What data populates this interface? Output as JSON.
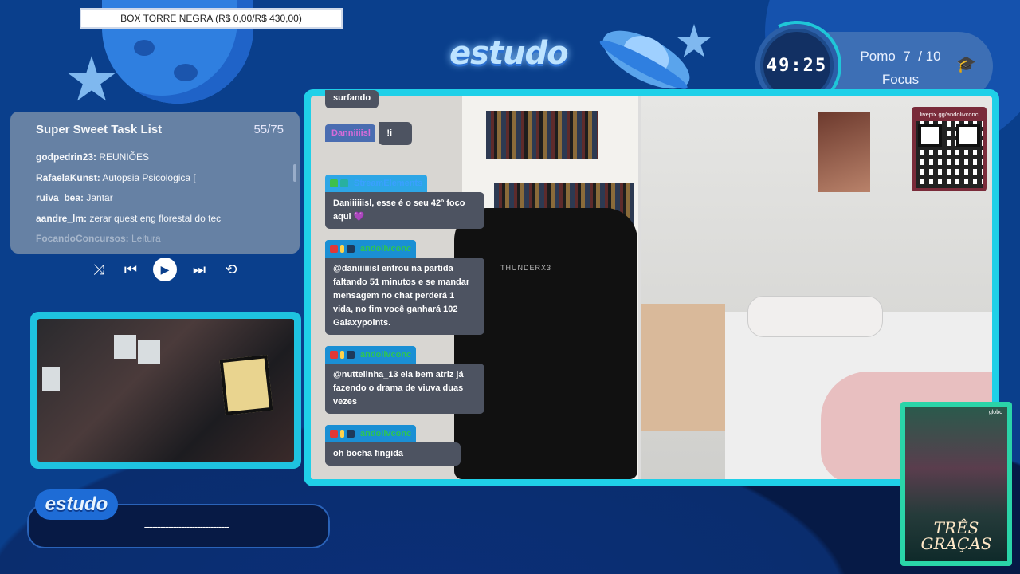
{
  "goal_bar": {
    "text": "BOX TORRE NEGRA (R$ 0,00/R$ 430,00)"
  },
  "brand": {
    "logo_text": "estudo"
  },
  "timer": {
    "time": "49:25",
    "mode_label": "Pomo",
    "pomo_current": "7",
    "pomo_total": "/ 10",
    "state": "Focus"
  },
  "task_list": {
    "title": "Super Sweet Task List",
    "count": "55/75",
    "items": [
      {
        "user": "godpedrin23:",
        "task": " REUNIÕES"
      },
      {
        "user": "RafaelaKunst:",
        "task": " Autopsia Psicologica ["
      },
      {
        "user": "ruiva_bea:",
        "task": " Jantar"
      },
      {
        "user": "aandre_lm:",
        "task": " zerar quest eng florestal do tec"
      },
      {
        "user": "FocandoConcursos:",
        "task": " Leitura"
      }
    ]
  },
  "player": {
    "shuffle": "⤨",
    "prev": "⏮",
    "play": "▶",
    "next": "⏭",
    "repeat": "⟲"
  },
  "ticker": {
    "text": "--------------------------------"
  },
  "qr": {
    "label": "livepix.gg/andolivconc"
  },
  "chat": [
    {
      "user": "",
      "body": "surfando"
    },
    {
      "user": "Danniiiisl",
      "body": "!i"
    },
    {
      "user": "StreamElements",
      "body": "Daniiiiiisl, esse é o seu 42º foco aqui 💜"
    },
    {
      "user": "andolivconc",
      "body": "@daniiiiiisl entrou na partida faltando 51 minutos e se mandar mensagem no chat perderá 1 vida, no fim você ganhará 102 Galaxypoints."
    },
    {
      "user": "andolivconc",
      "body": "@nuttelinha_13 ela bem atriz já fazendo o drama de viuva duas vezes"
    },
    {
      "user": "andolivconc",
      "body": "oh bocha fingida"
    }
  ],
  "poster": {
    "title": "TRÊS GRAÇAS",
    "network": "globo"
  },
  "camera": {
    "chair_brand": "THUNDERX3"
  },
  "colors": {
    "accent_cyan": "#1fd0e8",
    "bg_blue": "#0a3f8c",
    "chat_badge": "#1a8fd4",
    "chat_bubble": "#4d5361"
  }
}
